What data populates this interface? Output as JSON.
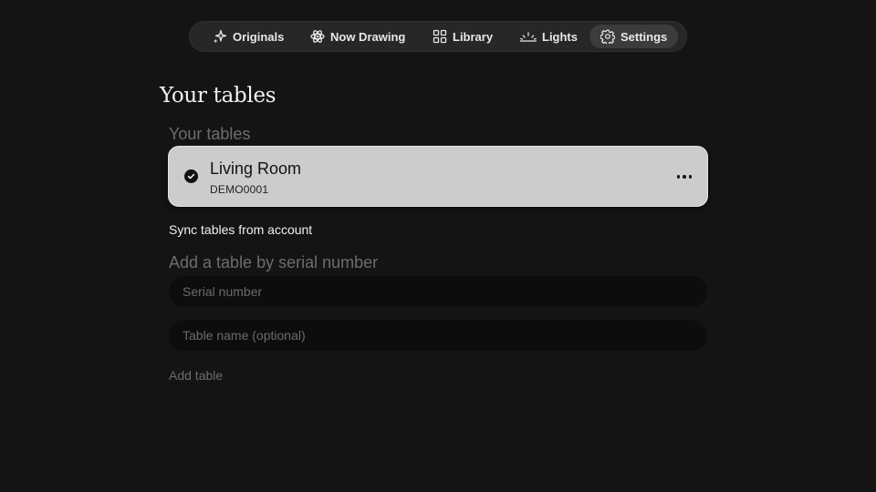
{
  "nav": {
    "items": [
      {
        "label": "Originals",
        "icon": "sparkle-icon",
        "active": false
      },
      {
        "label": "Now Drawing",
        "icon": "atom-icon",
        "active": false
      },
      {
        "label": "Library",
        "icon": "grid-icon",
        "active": false
      },
      {
        "label": "Lights",
        "icon": "sunrise-icon",
        "active": false
      },
      {
        "label": "Settings",
        "icon": "gear-icon",
        "active": true
      }
    ]
  },
  "page": {
    "title": "Your tables"
  },
  "tables": {
    "heading": "Your tables",
    "items": [
      {
        "name": "Living Room",
        "serial": "DEMO0001",
        "selected": true
      }
    ],
    "sync_label": "Sync tables from account"
  },
  "add_table": {
    "heading": "Add a table by serial number",
    "serial_placeholder": "Serial number",
    "serial_value": "",
    "name_placeholder": "Table name (optional)",
    "name_value": "",
    "submit_label": "Add table"
  },
  "colors": {
    "background": "#141414",
    "nav_background": "#262727",
    "nav_active": "#3b3c3c",
    "card_background": "#cbcdcc",
    "input_background": "#0d0d0d"
  }
}
